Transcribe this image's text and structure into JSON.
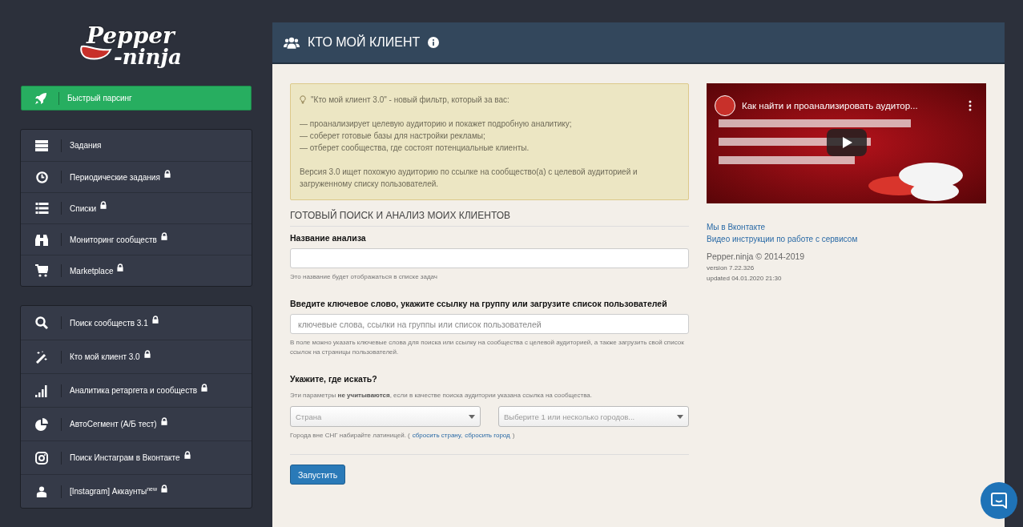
{
  "logo": {
    "line_1": "Pepper",
    "line_2": "-ninja"
  },
  "quick_button": {
    "label": "Быстрый парсинг"
  },
  "menu_groups": [
    {
      "items": [
        {
          "kind": "tasks",
          "label": "Задания",
          "locked": false
        },
        {
          "kind": "clock",
          "label": "Периодические задания",
          "locked": true
        },
        {
          "kind": "list",
          "label": "Списки",
          "locked": true
        },
        {
          "kind": "binoculars",
          "label": "Мониторинг сообществ",
          "locked": true
        },
        {
          "kind": "cart",
          "label": "Marketplace",
          "locked": true
        }
      ]
    },
    {
      "items": [
        {
          "kind": "search",
          "label": "Поиск сообществ 3.1",
          "locked": true
        },
        {
          "kind": "wand",
          "label": "Кто мой клиент 3.0",
          "locked": true
        },
        {
          "kind": "signal",
          "label": "Аналитика ретаргета и сообществ",
          "locked": true
        },
        {
          "kind": "pie",
          "label": "АвтоСегмент (А/Б тест)",
          "locked": true
        },
        {
          "kind": "instagram",
          "label": "Поиск Инстаграм в Вконтакте",
          "locked": true
        },
        {
          "kind": "user",
          "label": "[Instagram] Аккаунты$^{new}$",
          "locked": true
        }
      ]
    }
  ],
  "header": {
    "title": "КТО МОЙ КЛИЕНТ"
  },
  "notice": {
    "intro": "\"Кто мой клиент 3.0\" - новый фильтр, который за вас:",
    "bullets": [
      "— проанализирует целевую аудиторию и покажет подробную аналитику;",
      "— соберет готовые базы для настройки рекламы;",
      "— отберет сообщества, где состоят потенциальные клиенты."
    ],
    "footer": "Версия 3.0 ищет похожую аудиторию по ссылке на сообщество(а) с целевой аудиторией и загруженному списку пользователей."
  },
  "section_title": "ГОТОВЫЙ ПОИСК И АНАЛИЗ МОИХ КЛИЕНТОВ",
  "name_field": {
    "label": "Название анализа",
    "help": "Это название будет отображаться в списке задач"
  },
  "keyword_field": {
    "label": "Введите ключевое слово, укажите ссылку на группу или загрузите список пользователей",
    "placeholder": "ключевые слова, ссылки на группы или список пользователей",
    "help": "В поле можно указать ключевые слова для поиска или ссылку на сообщества с целевой аудиторией, а также загрузить свой список ссылок на страницы пользователей."
  },
  "location": {
    "label": "Укажите, где искать?",
    "note": "Эти параметры **не учитываются**, если в качестве поиска аудитории указана ссылка на сообщества.",
    "country_placeholder": "Страна",
    "city_placeholder": "Выберите 1 или несколько городов...",
    "hint": "Города вне СНГ набирайте латиницей. (",
    "reset_country": "сбросить страну,",
    "reset_city": "сбросить город",
    "hint_end": ")"
  },
  "submit_button": "Запустить",
  "video": {
    "title": "Как найти и проанализировать аудитор..."
  },
  "links": [
    "Мы в Вконтакте",
    "Видео инструкции по работе с сервисом"
  ],
  "copyright": "Pepper.ninja © 2014-2019",
  "version": "version 7.22.326",
  "updated": "updated 04.01.2020 21:30"
}
